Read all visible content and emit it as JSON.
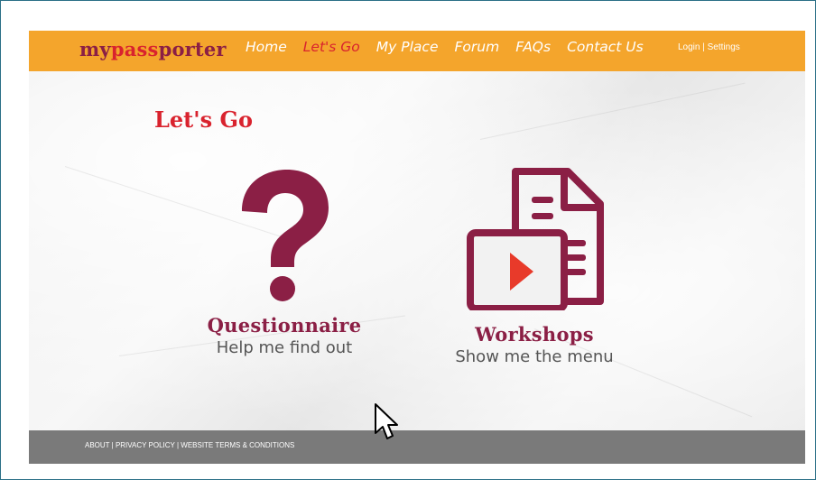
{
  "logo": {
    "my": "my",
    "pass": "pass",
    "porter": "porter"
  },
  "nav": [
    {
      "label": "Home",
      "active": false
    },
    {
      "label": "Let's Go",
      "active": true
    },
    {
      "label": "My Place",
      "active": false
    },
    {
      "label": "Forum",
      "active": false
    },
    {
      "label": "FAQs",
      "active": false
    },
    {
      "label": "Contact Us",
      "active": false
    }
  ],
  "account": {
    "login": "Login",
    "separator": " | ",
    "settings": "Settings"
  },
  "page_title": "Let's Go",
  "options": [
    {
      "title": "Questionnaire",
      "subtitle": "Help me find out",
      "icon": "question-mark-icon"
    },
    {
      "title": "Workshops",
      "subtitle": "Show me the menu",
      "icon": "document-video-icon"
    }
  ],
  "footer": {
    "links": "ABOUT | PRIVACY POLICY | WEBSITE TERMS & CONDITIONS"
  },
  "colors": {
    "header_bg": "#f4a52c",
    "brand_maroon": "#8b1f45",
    "brand_red": "#d9232e",
    "footer_bg": "#7a7a7a"
  }
}
